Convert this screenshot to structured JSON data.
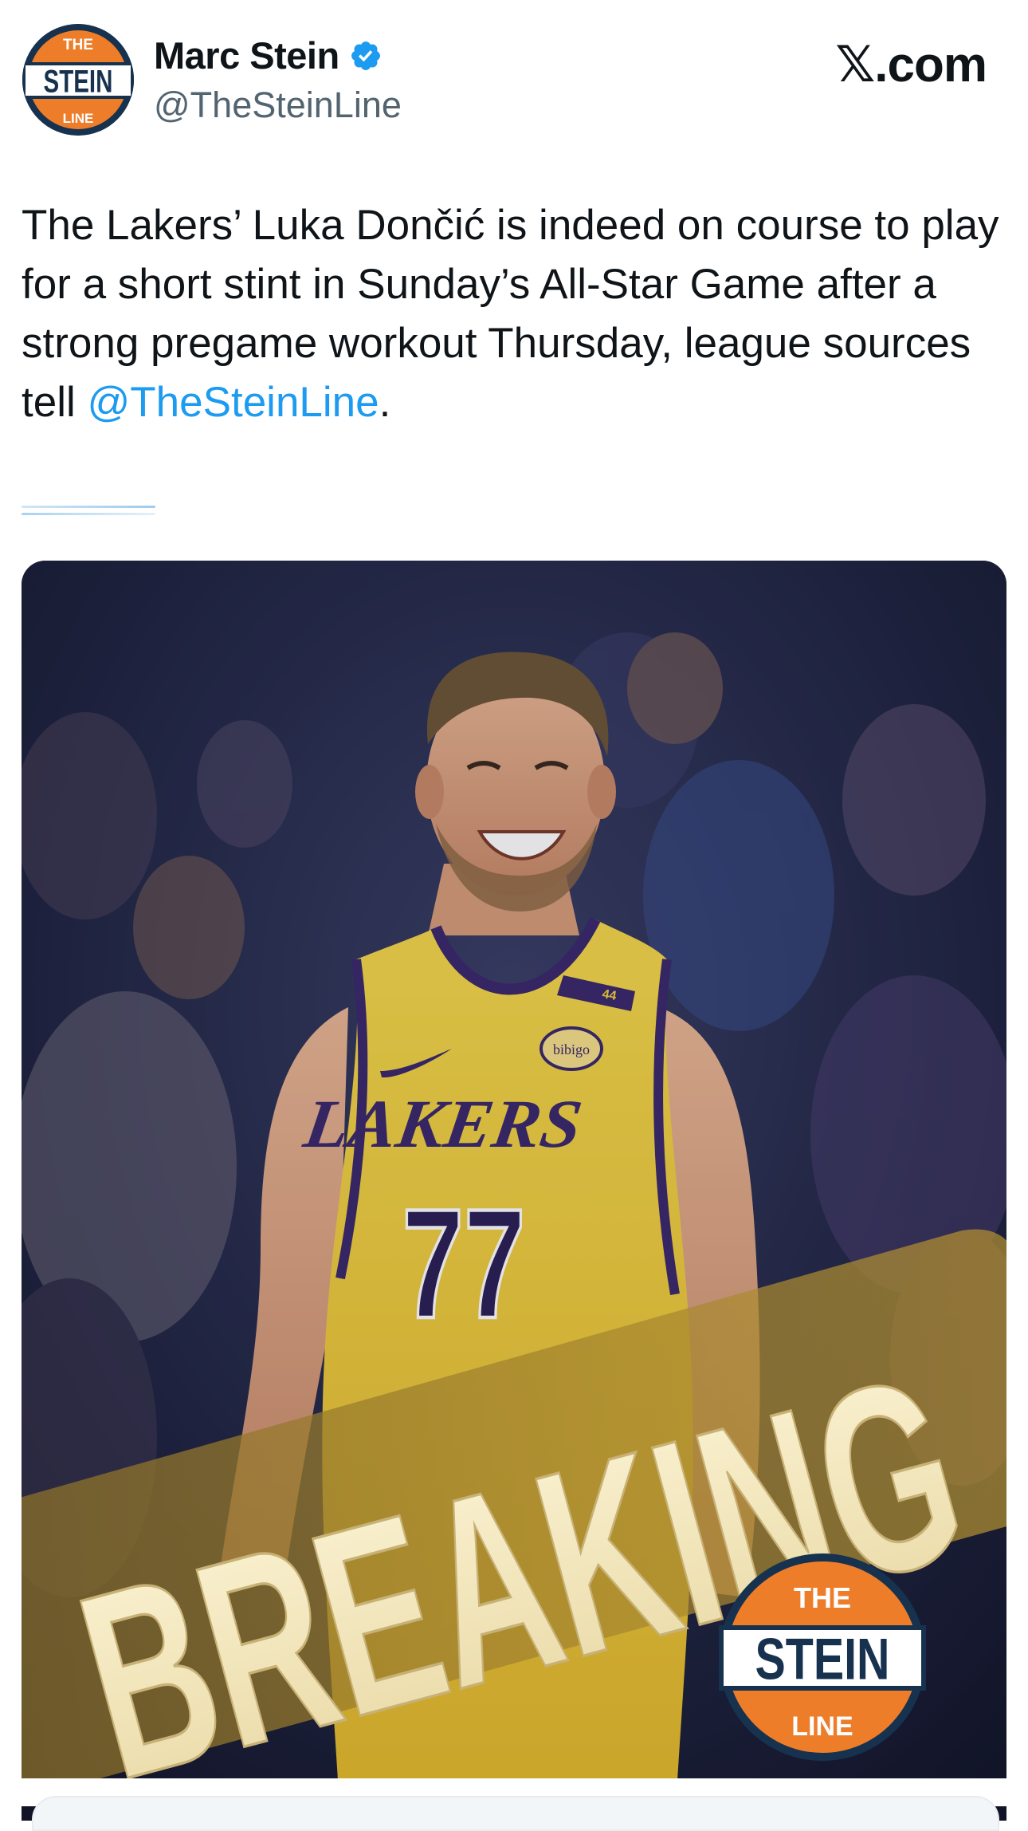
{
  "author": {
    "display_name": "Marc Stein",
    "handle": "@TheSteinLine",
    "verified": true,
    "avatar_logo": {
      "top": "THE",
      "middle": "STEIN",
      "bottom": "LINE"
    }
  },
  "brand": {
    "label": "𝕏.com"
  },
  "tweet": {
    "text_before_mention": "The Lakers’ Luka Dončić is indeed on course to play for a short stint in Sunday’s All-Star Game after a strong pregame workout Thursday, league sources tell ",
    "mention": "@TheSteinLine",
    "text_after_mention": "."
  },
  "media": {
    "jersey_brand": "LAKERS",
    "jersey_number": "77",
    "patch_text": "bibigo",
    "armband_text": "44",
    "overlay_text": "BREAKING",
    "watermark": {
      "top": "THE",
      "middle": "STEIN",
      "bottom": "LINE"
    }
  },
  "colors": {
    "mention": "#1d9bf0",
    "verified": "#1d9bf0",
    "lakers_gold": "#f2cf3a",
    "lakers_purple": "#3b2a6b",
    "logo_orange": "#ee7d2a",
    "logo_navy": "#17324f"
  },
  "icons": [
    "verified-badge-icon",
    "x-logo"
  ]
}
